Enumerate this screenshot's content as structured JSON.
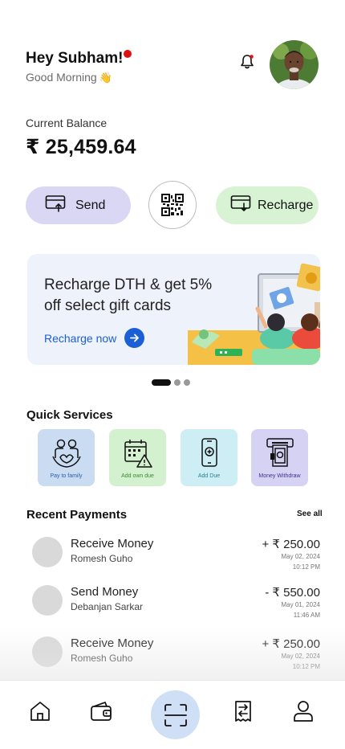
{
  "header": {
    "greeting": "Hey Subham!",
    "subtitle": "Good Morning",
    "subtitle_emoji": "👋",
    "notification_dot_color": "#e01010"
  },
  "balance": {
    "label": "Current Balance",
    "value": "₹ 25,459.64"
  },
  "actions": {
    "send_label": "Send",
    "recharge_label": "Recharge"
  },
  "banner": {
    "title": "Recharge DTH & get 5% off select gift cards",
    "link_label": "Recharge now"
  },
  "carousel": {
    "pages": 3,
    "active": 1
  },
  "quick_services": {
    "title": "Quick Services",
    "items": [
      {
        "label": "Pay to family",
        "icon": "family-icon",
        "bg": "#c9dcf1",
        "color": "#2d5da8"
      },
      {
        "label": "Add own due",
        "icon": "calendar-alert-icon",
        "bg": "#d4f1cf",
        "color": "#3a8a34"
      },
      {
        "label": "Add Due",
        "icon": "phone-add-icon",
        "bg": "#cdeef4",
        "color": "#2b7f94"
      },
      {
        "label": "Money Withdraw",
        "icon": "atm-icon",
        "bg": "#d5d2f3",
        "color": "#3b3590"
      }
    ]
  },
  "recent_payments": {
    "title": "Recent Payments",
    "see_all": "See all",
    "items": [
      {
        "type": "Receive Money",
        "name": "Romesh Guho",
        "amount": "+ ₹ 250.00",
        "date": "May 02, 2024",
        "time": "10:12 PM"
      },
      {
        "type": "Send Money",
        "name": "Debanjan Sarkar",
        "amount": "- ₹ 550.00",
        "date": "May 01, 2024",
        "time": "11:46 AM"
      },
      {
        "type": "Receive Money",
        "name": "Romesh Guho",
        "amount": "+ ₹ 250.00",
        "date": "May 02, 2024",
        "time": "10:12 PM"
      }
    ]
  },
  "bottom_nav": {
    "items": [
      "home-icon",
      "wallet-icon",
      "scan-icon",
      "bill-icon",
      "profile-icon"
    ],
    "active_bg": "#cfe0f6"
  }
}
